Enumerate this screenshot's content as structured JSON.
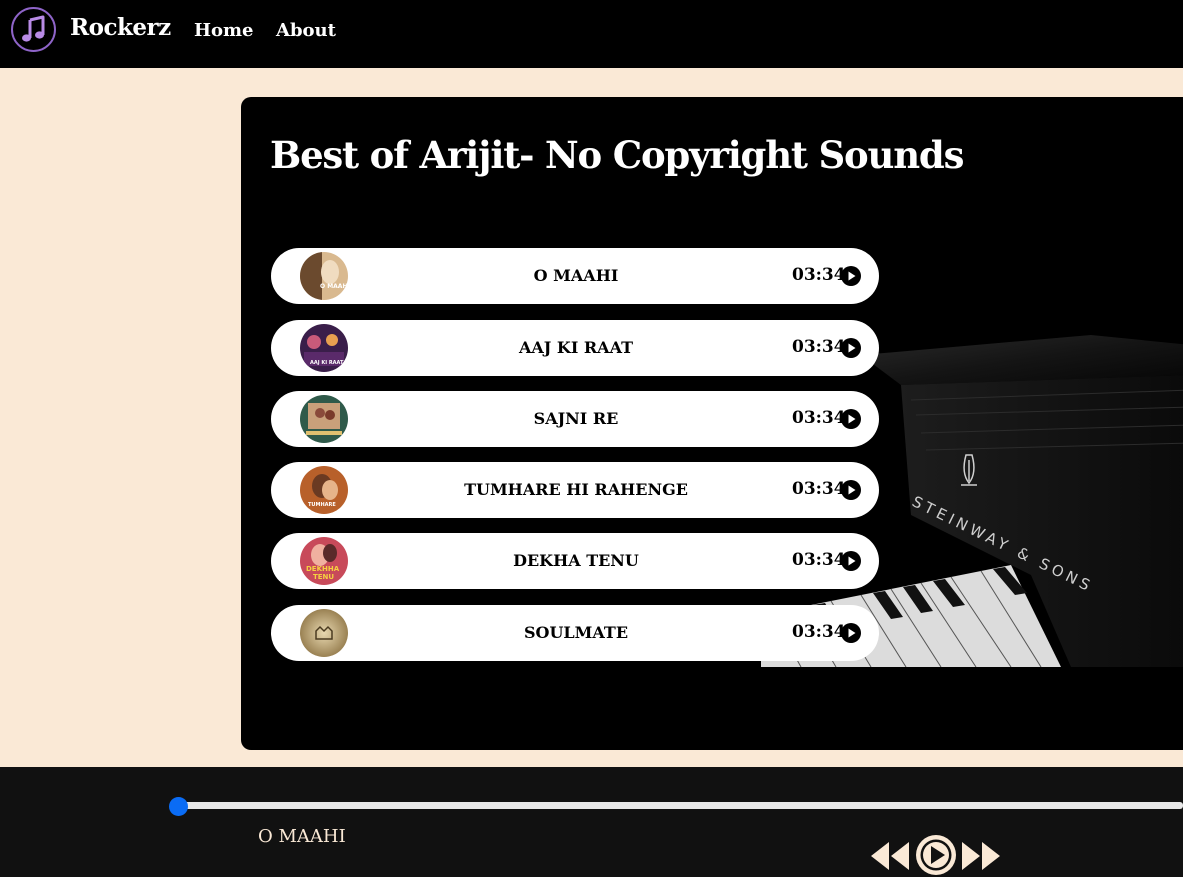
{
  "app": {
    "brand": "Rockerz"
  },
  "nav": {
    "links": [
      "Home",
      "About"
    ]
  },
  "playlist": {
    "title": "Best of Arijit- No Copyright Sounds",
    "songs": [
      {
        "name": "O MAAHI",
        "duration": "03:34"
      },
      {
        "name": "AAJ KI RAAT",
        "duration": "03:34"
      },
      {
        "name": "SAJNI RE",
        "duration": "03:34"
      },
      {
        "name": "TUMHARE HI RAHENGE",
        "duration": "03:34"
      },
      {
        "name": "DEKHA TENU",
        "duration": "03:34"
      },
      {
        "name": "SOULMATE",
        "duration": "03:34"
      }
    ]
  },
  "player": {
    "current_song": "O MAAHI",
    "progress": 0
  },
  "colors": {
    "page_background": "#FAE9D6",
    "nav_background": "#000000",
    "accent_purple": "#8E64C8",
    "seek_thumb": "#0A6CF5",
    "control_color": "#FAE9D6"
  },
  "icons": {
    "logo": "music-note-icon",
    "song_play": "play-circle-icon",
    "previous": "previous-icon",
    "master_play": "play-circle-icon",
    "next": "next-icon"
  }
}
